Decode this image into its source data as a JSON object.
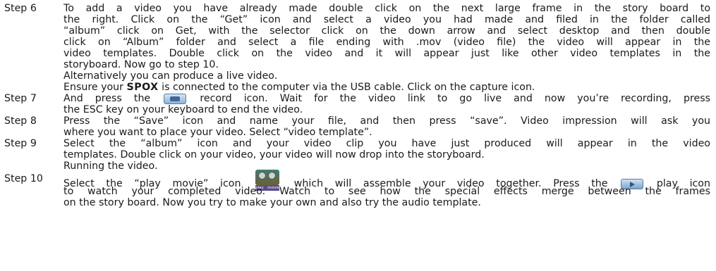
{
  "steps": {
    "s6": {
      "label": "Step 6",
      "lines": [
        "To add a video you have already made double click on the next large frame in the story board to",
        "the right. Click on the “Get” icon and select a  video you had made and filed in the folder called",
        "“album” click on Get, with the selector click on the down arrow and select desktop and then double",
        "click on “Album” folder and select a file ending with .mov (video file) the video will appear in the",
        "video templates. Double click on the video and it will appear just like other video templates in the",
        "storyboard.  Now go to step 10.",
        "Alternatively you can produce a live video."
      ],
      "ensure_pre": "Ensure your ",
      "brand": "SPOX",
      "ensure_post": " is connected to the computer via the USB cable. Click on the capture icon."
    },
    "s7": {
      "label": "Step 7",
      "line1_pre": "And press the",
      "line1_post": "record icon. Wait for the video link to go live and now you’re recording, press",
      "line2": "the ESC key on your keyboard to end the video."
    },
    "s8": {
      "label": "Step 8",
      "lines": [
        "Press the “Save” icon and name your file, and then press “save”. Video impression will ask you",
        "where you want to place your video. Select “video template”."
      ]
    },
    "s9": {
      "label": "Step 9",
      "lines": [
        "Select the “album” icon and your video clip you have just produced will appear in the video",
        "templates. Double  click on your video, your video will now drop into the storyboard.",
        "Running the video."
      ]
    },
    "s10": {
      "label": "Step 10",
      "line1_pre": "Select the “play movie” icon",
      "movie_caption": "play movie",
      "line1_post": "which will assemble your video together. Press the",
      "line1_end": "play icon",
      "lines": [
        "to watch your completed video. Watch to see how the special effects merge between the frames",
        "on the story board. Now you try to make your own and also try the audio template."
      ]
    }
  }
}
